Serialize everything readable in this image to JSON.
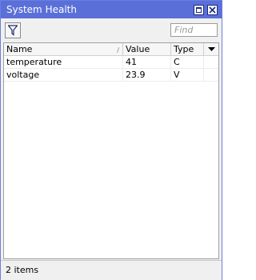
{
  "window": {
    "title": "System Health",
    "accent_color": "#5a6fd8",
    "buttons": [
      "maximize-icon",
      "close-icon"
    ]
  },
  "toolbar": {
    "filter_icon": "filter-icon",
    "find_placeholder": "Find",
    "find_value": ""
  },
  "table": {
    "columns": [
      "Name",
      "Value",
      "Type"
    ],
    "sort_column": "Name",
    "rows": [
      {
        "name": "temperature",
        "value": "41",
        "type": "C"
      },
      {
        "name": "voltage",
        "value": "23.9",
        "type": "V"
      }
    ]
  },
  "status": {
    "text": "2 items"
  }
}
